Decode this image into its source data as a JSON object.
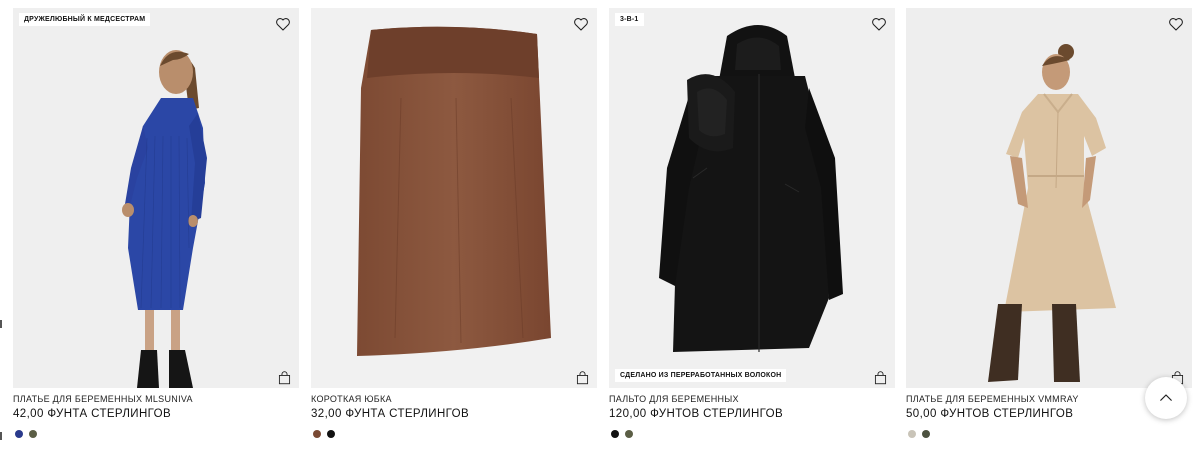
{
  "products": [
    {
      "title": "ПЛАТЬЕ ДЛЯ БЕРЕМЕННЫХ MLSUNIVA",
      "price": "42,00 ФУНТА СТЕРЛИНГОВ",
      "badge_top": "ДРУЖЕЛЮБНЫЙ К МЕДСЕСТРАМ",
      "badge_bottom": "",
      "swatches": [
        "#2a3a8c",
        "#5b5e45"
      ]
    },
    {
      "title": "КОРОТКАЯ ЮБКА",
      "price": "32,00 ФУНТА СТЕРЛИНГОВ",
      "badge_top": "",
      "badge_bottom": "",
      "swatches": [
        "#7a4a34",
        "#111111"
      ]
    },
    {
      "title": "ПАЛЬТО ДЛЯ БЕРЕМЕННЫХ",
      "price": "120,00 ФУНТОВ СТЕРЛИНГОВ",
      "badge_top": "3-В-1",
      "badge_bottom": "СДЕЛАНО ИЗ ПЕРЕРАБОТАННЫХ ВОЛОКОН",
      "swatches": [
        "#111111",
        "#5b5e45"
      ]
    },
    {
      "title": "ПЛАТЬЕ ДЛЯ БЕРЕМЕННЫХ VMMRAY",
      "price": "50,00 ФУНТОВ СТЕРЛИНГОВ",
      "badge_top": "",
      "badge_bottom": "",
      "swatches": [
        "#c9c4b8",
        "#4d5240"
      ]
    }
  ],
  "icons": {
    "wishlist": "heart-icon",
    "add_to_bag": "shopping-bag-icon",
    "scroll_top": "chevron-up-icon"
  }
}
